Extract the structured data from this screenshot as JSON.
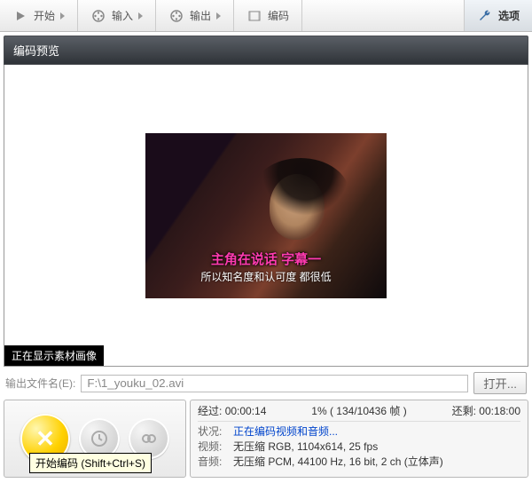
{
  "toolbar": {
    "start": "开始",
    "input": "输入",
    "output": "输出",
    "encode": "编码",
    "options": "选项"
  },
  "panel": {
    "title": "编码预览",
    "subtitle1": "主角在说话 字幕一",
    "subtitle2": "所以知名度和认可度 都很低",
    "status_tag": "正在显示素材画像"
  },
  "file": {
    "label": "输出文件名(E):",
    "value": "F:\\1_youku_02.avi",
    "browse": "打开..."
  },
  "controls": {
    "tooltip": "开始编码 (Shift+Ctrl+S)"
  },
  "info": {
    "elapsed_label": "经过:",
    "elapsed_value": "00:00:14",
    "progress": "1% ( 134/10436  帧 )",
    "remain_label": "还剩:",
    "remain_value": "00:18:00",
    "status_label": "状况:",
    "status_value": "正在编码视频和音频...",
    "video_label": "视频:",
    "video_value": "无压缩 RGB, 1104x614, 25 fps",
    "audio_label": "音频:",
    "audio_value": "无压缩 PCM, 44100 Hz, 16 bit, 2 ch (立体声)"
  }
}
